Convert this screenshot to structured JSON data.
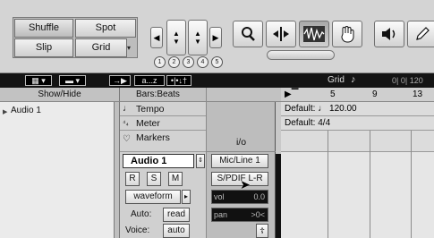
{
  "toolbar": {
    "modes": {
      "shuffle": "Shuffle",
      "spot": "Spot",
      "slip": "Slip",
      "grid": "Grid"
    },
    "zoom_presets": [
      "1",
      "2",
      "3",
      "4",
      "5"
    ],
    "icons": [
      "search-icon",
      "zoom-in-out-icon",
      "trim-icon",
      "selector-icon",
      "grabber-icon",
      "speaker-icon",
      "pencil-icon"
    ]
  },
  "edit_bar": {
    "range": "a...z",
    "grid_label": "Grid",
    "counter": "0| 0| 120"
  },
  "columns": {
    "show_hide": "Show/Hide",
    "bars_beats": "Bars:Beats",
    "io": "i/o"
  },
  "show_hide_list": [
    "Audio 1"
  ],
  "rulers": {
    "tempo": "Tempo",
    "meter": "Meter",
    "markers": "Markers"
  },
  "timeline": {
    "bar_numbers": [
      "5",
      "9",
      "13"
    ],
    "tempo_default": "Default:",
    "tempo_value": "120.00",
    "meter_default": "Default: 4/4"
  },
  "track": {
    "name": "Audio 1",
    "buttons": [
      "R",
      "S",
      "M"
    ],
    "view": "waveform",
    "auto_label": "Auto:",
    "auto_value": "read",
    "voice_label": "Voice:",
    "voice_value": "auto",
    "input": "Mic/Line 1",
    "output": "S/PDIF L-R",
    "vol_label": "vol",
    "vol_value": "0.0",
    "pan_label": "pan",
    "pan_value": ">0<"
  }
}
